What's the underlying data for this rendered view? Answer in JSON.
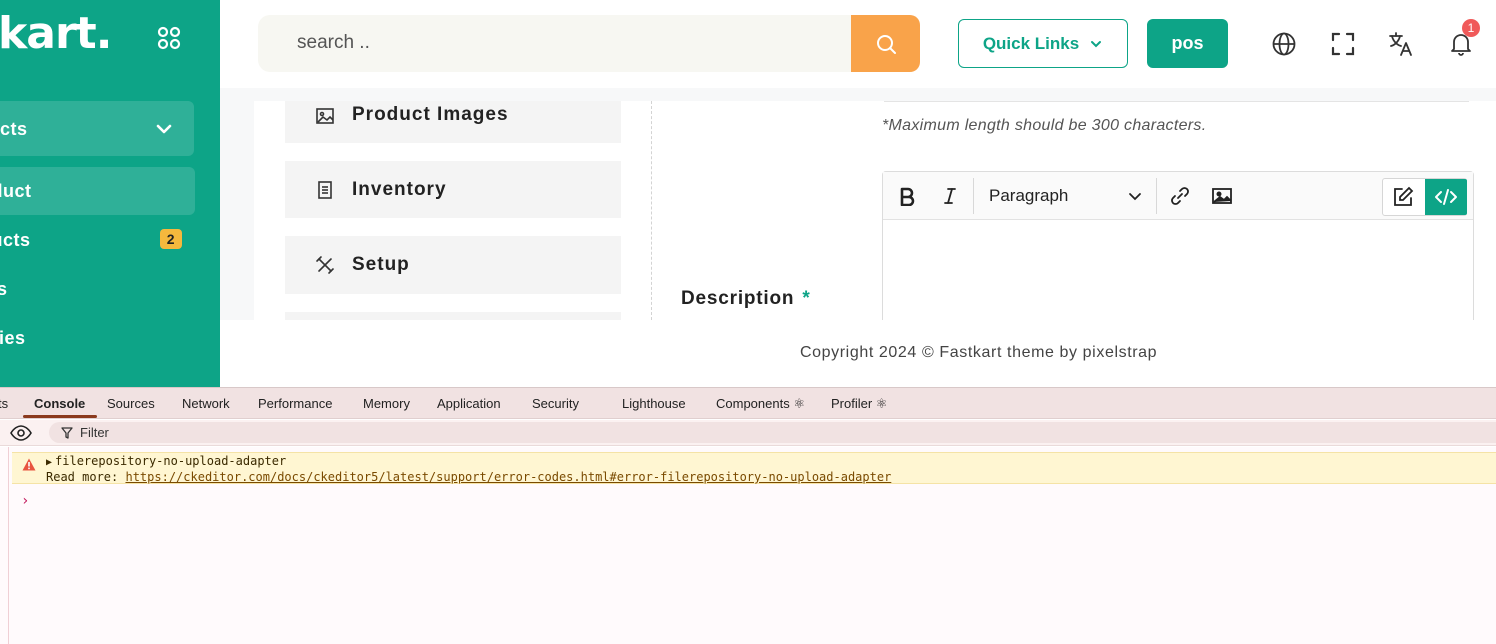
{
  "sidebar": {
    "logo": "tkart.",
    "menu_parent": "cts",
    "items": [
      {
        "label": "oduct",
        "active": true
      },
      {
        "label": "ducts",
        "badge": "2"
      },
      {
        "label": "tes"
      },
      {
        "label": "ories"
      }
    ]
  },
  "header": {
    "search_placeholder": "search ..",
    "quick_links": "Quick Links",
    "pos": "pos",
    "notification_count": "1"
  },
  "content": {
    "tabs": [
      {
        "label": "Product Images",
        "icon": "image-icon"
      },
      {
        "label": "Inventory",
        "icon": "list-icon"
      },
      {
        "label": "Setup",
        "icon": "tools-icon"
      }
    ],
    "max_length_note": "*Maximum length should be 300 characters.",
    "description_label": "Description",
    "required_mark": "*",
    "editor": {
      "paragraph_select": "Paragraph"
    }
  },
  "footer": {
    "copyright": "Copyright 2024 © Fastkart theme by pixelstrap"
  },
  "devtools": {
    "tabs": [
      "ts",
      "Console",
      "Sources",
      "Network",
      "Performance",
      "Memory",
      "Application",
      "Security",
      "Lighthouse",
      "Components ⚛",
      "Profiler ⚛"
    ],
    "active_tab": "Console",
    "filter_placeholder": "Filter",
    "warning": {
      "title": "filerepository-no-upload-adapter",
      "read_more": "Read more:",
      "link": "https://ckeditor.com/docs/ckeditor5/latest/support/error-codes.html#error-filerepository-no-upload-adapter"
    },
    "prompt": "›"
  },
  "colors": {
    "brand": "#0da487",
    "search_button": "#f9a34a",
    "badge": "#f5b83d",
    "notification": "#f05a5a"
  }
}
